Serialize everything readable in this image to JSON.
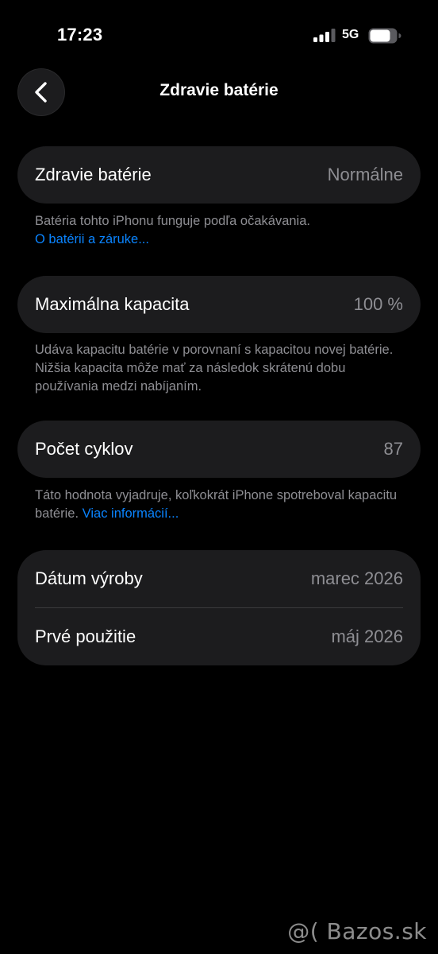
{
  "status_bar": {
    "time": "17:23",
    "network": "5G",
    "icons": [
      "signal-icon",
      "battery-icon"
    ]
  },
  "nav": {
    "back_icon": "chevron-left-icon",
    "title": "Zdravie batérie"
  },
  "health": {
    "label": "Zdravie batérie",
    "value": "Normálne",
    "footnote": "Batéria tohto iPhonu funguje podľa očakávania.",
    "link": "O batérii a záruke..."
  },
  "capacity": {
    "label": "Maximálna kapacita",
    "value": "100 %",
    "footnote": "Udáva kapacitu batérie v porovnaní s kapacitou novej batérie. Nižšia kapacita môže mať za následok skrátenú dobu používania medzi nabíjaním."
  },
  "cycles": {
    "label": "Počet cyklov",
    "value": "87",
    "footnote": "Táto hodnota vyjadruje, koľkokrát iPhone spotreboval kapacitu batérie.",
    "link": "Viac informácií..."
  },
  "dates": {
    "manufacture_label": "Dátum výroby",
    "manufacture_value": "marec 2026",
    "first_use_label": "Prvé použitie",
    "first_use_value": "máj 2026"
  },
  "watermark": "@( Bazos.sk",
  "colors": {
    "background": "#000000",
    "card": "#1c1c1e",
    "secondary_text": "#8e8e93",
    "link": "#0a84ff",
    "divider": "#3a3a3c"
  }
}
